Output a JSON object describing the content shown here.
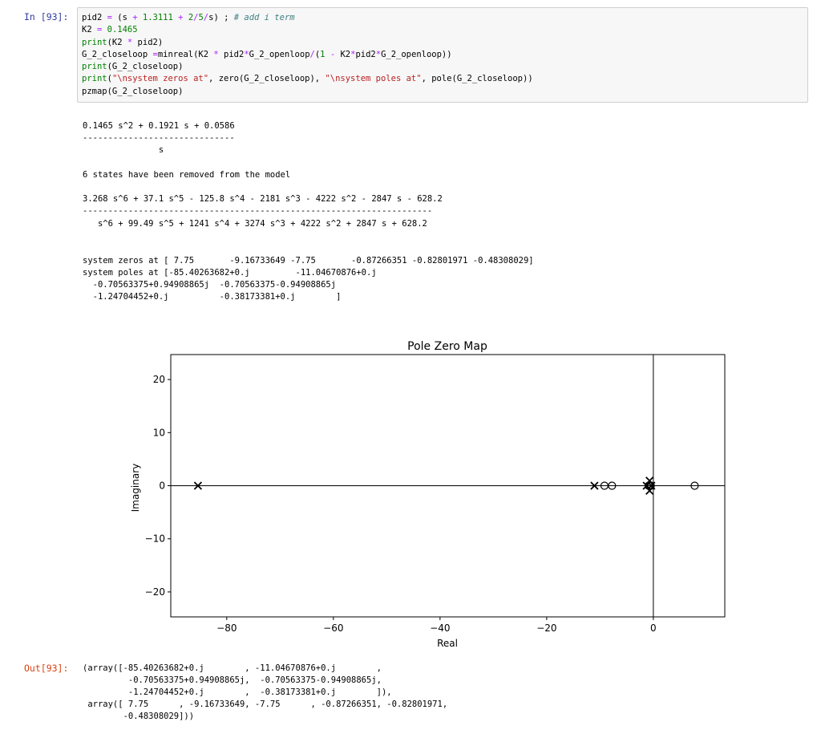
{
  "cell": {
    "in_prompt": "In [93]:",
    "out_prompt": "Out[93]:",
    "code_lines": [
      "pid2 = (s + 1.3111 + 2/5/s) ; # add i term",
      "K2 = 0.1465",
      "print(K2 * pid2)",
      "G_2_closeloop =minreal(K2 * pid2*G_2_openloop/(1 - K2*pid2*G_2_openloop))",
      "print(G_2_closeloop)",
      "print(\"\\nsystem zeros at\", zero(G_2_closeloop), \"\\nsystem poles at\", pole(G_2_closeloop))",
      "pzmap(G_2_closeloop)"
    ]
  },
  "stdout": {
    "tf1_num": "0.1465 s^2 + 0.1921 s + 0.0586",
    "tf1_bar": "------------------------------",
    "tf1_den": "               s",
    "removed": "6 states have been removed from the model",
    "tf2_num": "3.268 s^6 + 37.1 s^5 - 125.8 s^4 - 2181 s^3 - 4222 s^2 - 2847 s - 628.2",
    "tf2_bar": "---------------------------------------------------------------------",
    "tf2_den": "   s^6 + 99.49 s^5 + 1241 s^4 + 3274 s^3 + 4222 s^2 + 2847 s + 628.2",
    "zeros_line": "system zeros at [ 7.75       -9.16733649 -7.75       -0.87266351 -0.82801971 -0.48308029]",
    "poles_line1": "system poles at [-85.40263682+0.j         -11.04670876+0.j",
    "poles_line2": "  -0.70563375+0.94908865j  -0.70563375-0.94908865j",
    "poles_line3": "  -1.24704452+0.j          -0.38173381+0.j        ]"
  },
  "out_text": {
    "line1": "(array([-85.40263682+0.j        , -11.04670876+0.j        ,",
    "line2": "         -0.70563375+0.94908865j,  -0.70563375-0.94908865j,",
    "line3": "         -1.24704452+0.j        ,  -0.38173381+0.j        ]),",
    "line4": " array([ 7.75      , -9.16733649, -7.75      , -0.87266351, -0.82801971,",
    "line5": "        -0.48308029]))"
  },
  "colors": {
    "in_prompt": "#303f9f",
    "out_prompt": "#d84315",
    "cell_bg": "#f7f7f7"
  },
  "chart_data": {
    "type": "scatter",
    "title": "Pole Zero Map",
    "xlabel": "Real",
    "ylabel": "Imaginary",
    "xlim": [
      -90.5,
      13.4
    ],
    "ylim": [
      -24.7,
      24.7
    ],
    "xticks": [
      -80,
      -60,
      -40,
      -20,
      0
    ],
    "xtick_labels": [
      "−80",
      "−60",
      "−40",
      "−20",
      "0"
    ],
    "yticks": [
      -20,
      -10,
      0,
      10,
      20
    ],
    "ytick_labels": [
      "−20",
      "−10",
      "0",
      "10",
      "20"
    ],
    "grid": false,
    "axis_lines": true,
    "poles": [
      {
        "re": -85.40263682,
        "im": 0
      },
      {
        "re": -11.04670876,
        "im": 0
      },
      {
        "re": -0.70563375,
        "im": 0.94908865
      },
      {
        "re": -0.70563375,
        "im": -0.94908865
      },
      {
        "re": -1.24704452,
        "im": 0
      },
      {
        "re": -0.38173381,
        "im": 0
      }
    ],
    "zeros": [
      {
        "re": 7.75,
        "im": 0
      },
      {
        "re": -9.16733649,
        "im": 0
      },
      {
        "re": -7.75,
        "im": 0
      },
      {
        "re": -0.87266351,
        "im": 0
      },
      {
        "re": -0.82801971,
        "im": 0
      },
      {
        "re": -0.48308029,
        "im": 0
      }
    ]
  }
}
